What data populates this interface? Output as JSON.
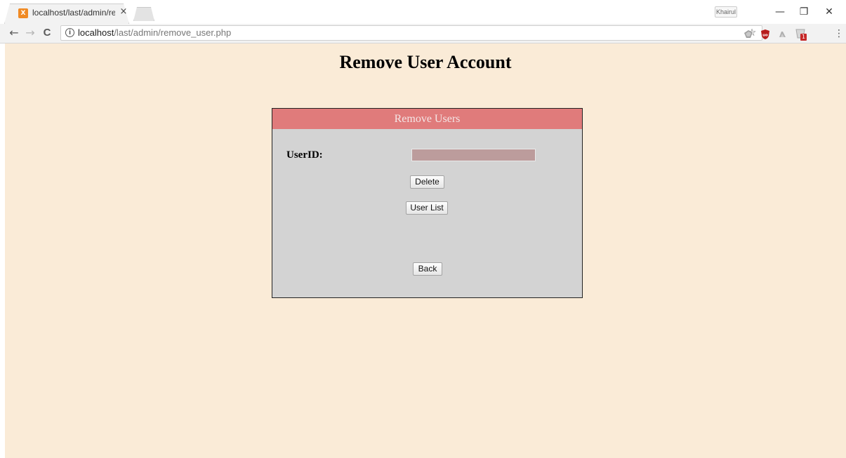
{
  "browser": {
    "tab_title": "localhost/last/admin/rem",
    "tab_close": "×",
    "favicon_text": "X",
    "profile": "Khairul",
    "window_controls": {
      "minimize": "—",
      "restore": "❐",
      "close": "✕"
    },
    "nav": {
      "back": "←",
      "forward": "→",
      "reload": "C"
    },
    "url_host": "localhost",
    "url_path": "/last/admin/remove_user.php",
    "info_icon": "i",
    "bookmark_star": "☆",
    "menu": "⋮",
    "extension_badge": "1",
    "colors": {
      "accent_extension_red": "#c62828",
      "extension_grey": "#9e9e9e"
    }
  },
  "page": {
    "title": "Remove User Account",
    "background": "#faebd7",
    "panel": {
      "header": "Remove Users",
      "header_color": "#e07b7b",
      "body_color": "#d3d3d3",
      "userid_label": "UserID:",
      "userid_value": "",
      "delete_label": "Delete",
      "user_list_label": "User List",
      "back_label": "Back"
    }
  }
}
